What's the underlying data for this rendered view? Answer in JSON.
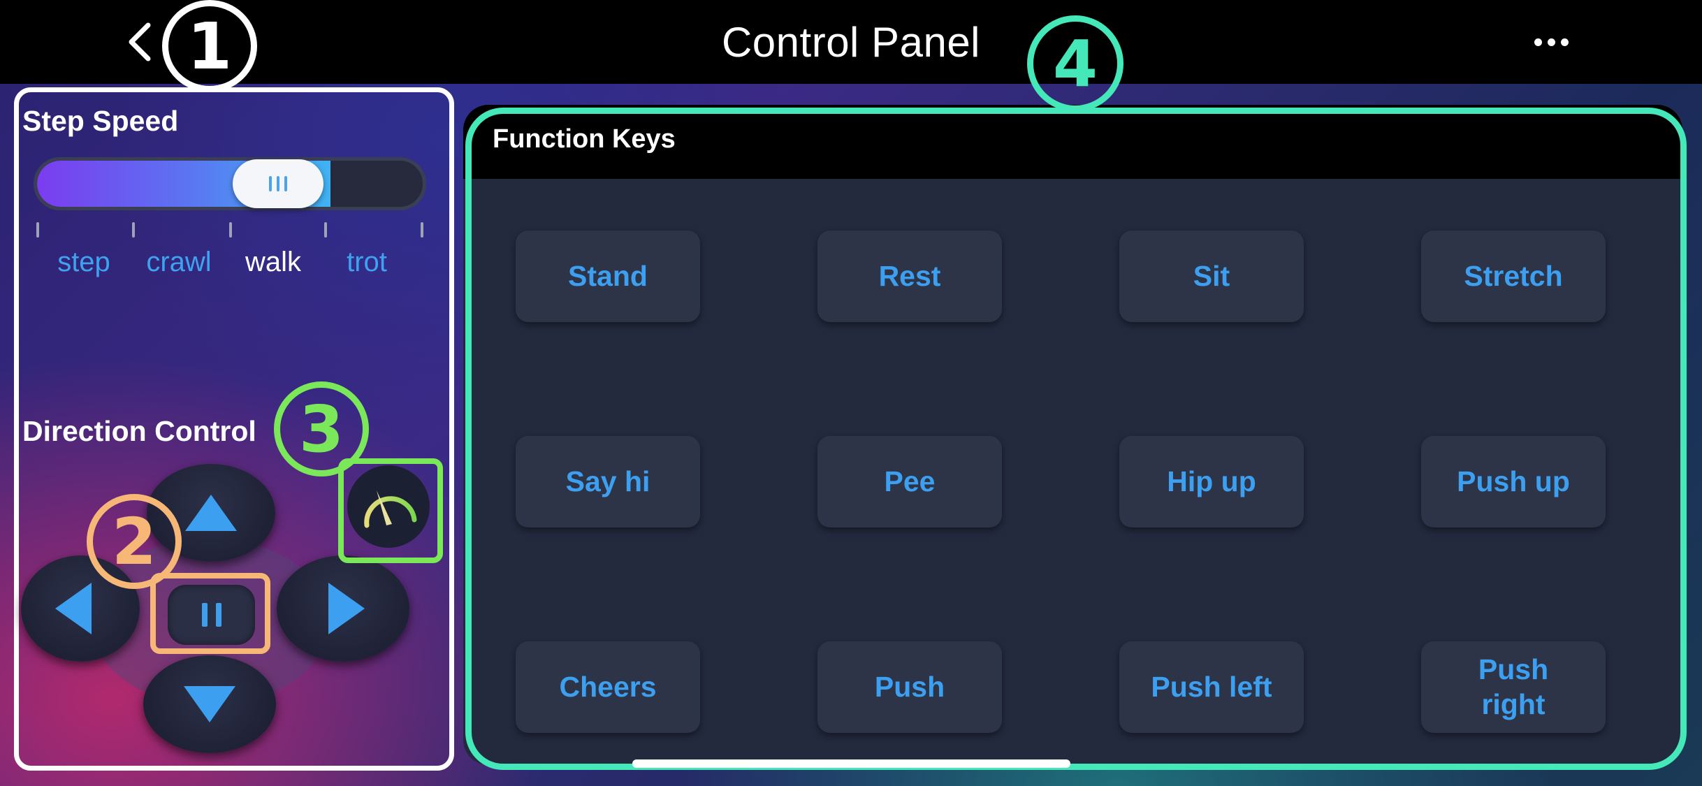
{
  "header": {
    "title": "Control Panel",
    "back_icon": "chevron-left-icon",
    "more_icon": "more-dots-icon"
  },
  "step_speed": {
    "title": "Step Speed",
    "options": [
      "step",
      "crawl",
      "walk",
      "trot"
    ],
    "selected": "walk",
    "slider_fraction": 0.62
  },
  "direction": {
    "title": "Direction Control",
    "up_icon": "arrow-up-icon",
    "down_icon": "arrow-down-icon",
    "left_icon": "arrow-left-icon",
    "right_icon": "arrow-right-icon",
    "pause_icon": "pause-icon",
    "gauge_icon": "speedometer-icon"
  },
  "function_keys": {
    "title": "Function Keys",
    "keys": [
      [
        "Stand",
        "Rest",
        "Sit",
        "Stretch"
      ],
      [
        "Say hi",
        "Pee",
        "Hip up",
        "Push up"
      ],
      [
        "Cheers",
        "Push",
        "Push left",
        "Push\nright"
      ]
    ]
  },
  "annotations": {
    "m1": "1",
    "m2": "2",
    "m3": "3",
    "m4": "4"
  },
  "colors": {
    "accent_blue": "#3c9ff0",
    "mark_white": "#ffffff",
    "mark_orange": "#f7b877",
    "mark_green": "#7be85a",
    "mark_teal": "#45e8b8"
  }
}
